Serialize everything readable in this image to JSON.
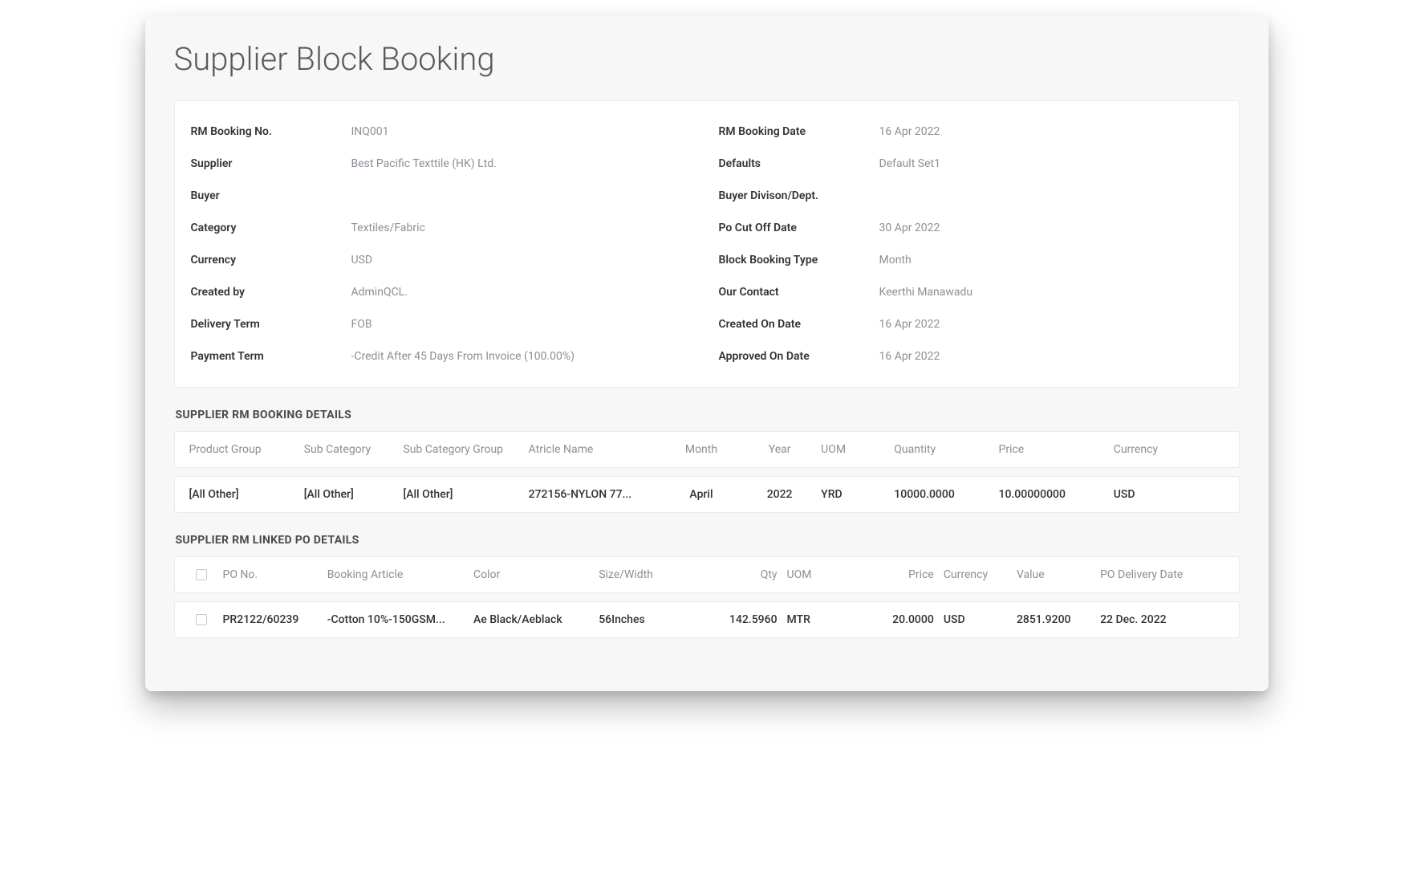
{
  "pageTitle": "Supplier Block Booking",
  "details": {
    "left": {
      "rmBookingNoLabel": "RM Booking No.",
      "rmBookingNo": "INQ001",
      "supplierLabel": "Supplier",
      "supplier": "Best Pacific Texttile (HK) Ltd.",
      "buyerLabel": "Buyer",
      "buyer": "",
      "categoryLabel": "Category",
      "category": "Textiles/Fabric",
      "currencyLabel": "Currency",
      "currency": "USD",
      "createdByLabel": "Created by",
      "createdBy": "AdminQCL.",
      "deliveryTermLabel": "Delivery Term",
      "deliveryTerm": "FOB",
      "paymentTermLabel": "Payment Term",
      "paymentTerm": "-Credit After 45 Days From Invoice (100.00%)"
    },
    "right": {
      "rmBookingDateLabel": "RM Booking Date",
      "rmBookingDate": "16 Apr 2022",
      "defaultsLabel": "Defaults",
      "defaults": "Default Set1",
      "buyerDivisionLabel": "Buyer Divison/Dept.",
      "buyerDivision": "",
      "poCutOffDateLabel": "Po Cut Off Date",
      "poCutOffDate": "30 Apr 2022",
      "blockBookingTypeLabel": "Block Booking Type",
      "blockBookingType": "Month",
      "ourContactLabel": "Our Contact",
      "ourContact": "Keerthi Manawadu",
      "createdOnDateLabel": "Created On Date",
      "createdOnDate": "16 Apr 2022",
      "approvedOnDateLabel": "Approved On Date",
      "approvedOnDate": "16 Apr 2022"
    }
  },
  "bookingSection": {
    "heading": "SUPPLIER RM BOOKING DETAILS",
    "headers": {
      "productGroup": "Product Group",
      "subCategory": "Sub Category",
      "subCategoryGroup": "Sub Category Group",
      "articleName": "Atricle Name",
      "month": "Month",
      "year": "Year",
      "uom": "UOM",
      "quantity": "Quantity",
      "price": "Price",
      "currency": "Currency"
    },
    "row": {
      "productGroup": "[All Other]",
      "subCategory": "[All Other]",
      "subCategoryGroup": "[All Other]",
      "articleName": "272156-NYLON 77...",
      "month": "April",
      "year": "2022",
      "uom": "YRD",
      "quantity": "10000.0000",
      "price": "10.00000000",
      "currency": "USD"
    }
  },
  "linkedPoSection": {
    "heading": "SUPPLIER RM LINKED PO DETAILS",
    "headers": {
      "poNo": "PO No.",
      "bookingArticle": "Booking Article",
      "color": "Color",
      "sizeWidth": "Size/Width",
      "qty": "Qty",
      "uom": "UOM",
      "price": "Price",
      "currency": "Currency",
      "value": "Value",
      "poDeliveryDate": "PO Delivery Date"
    },
    "row": {
      "poNo": "PR2122/60239",
      "bookingArticle": "-Cotton 10%-150GSM...",
      "color": "Ae Black/Aeblack",
      "sizeWidth": "56Inches",
      "qty": "142.5960",
      "uom": "MTR",
      "price": "20.0000",
      "currency": "USD",
      "value": "2851.9200",
      "poDeliveryDate": "22 Dec. 2022"
    }
  }
}
